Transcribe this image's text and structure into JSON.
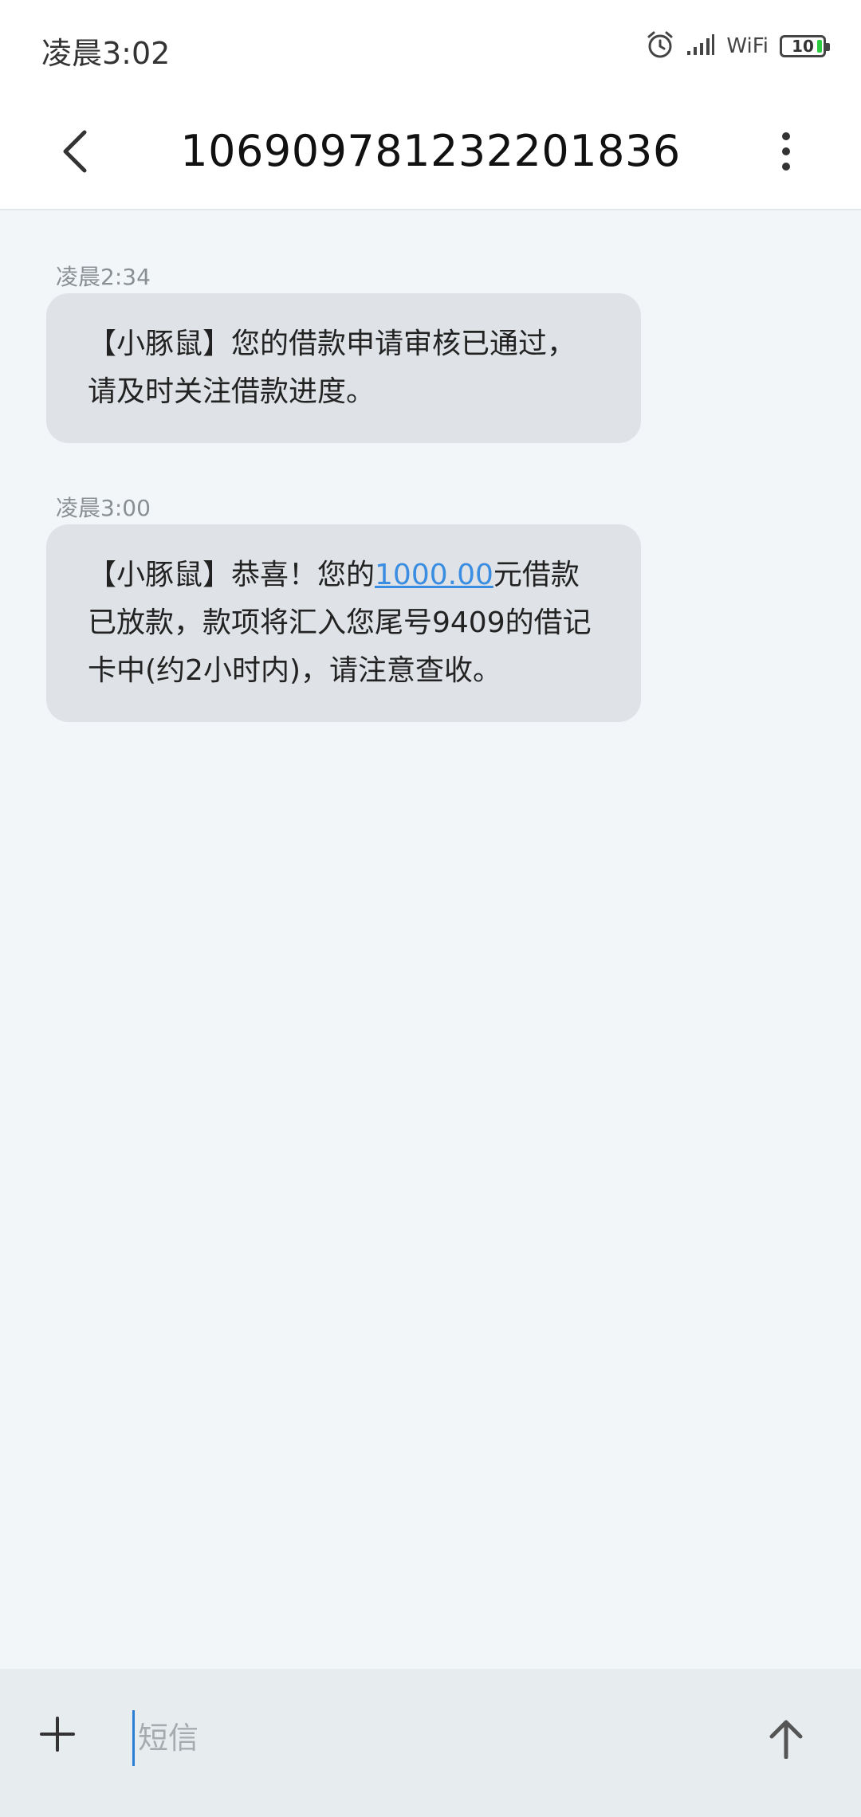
{
  "status_bar": {
    "time": "凌晨3:02",
    "wifi_label": "WiFi",
    "battery_level": "10",
    "icons": [
      "alarm-icon",
      "signal-icon",
      "battery-icon"
    ]
  },
  "header": {
    "title": "106909781232201836",
    "icons": [
      "chevron-left-icon",
      "more-vertical-icon"
    ]
  },
  "messages": [
    {
      "time": "凌晨2:34",
      "text": "【小豚鼠】您的借款申请审核已通过，请及时关注借款进度。"
    },
    {
      "time": "凌晨3:00",
      "text_before": "【小豚鼠】恭喜！您的",
      "amount": "1000.00",
      "text_after": "元借款已放款，款项将汇入您尾号9409的借记卡中(约2小时内)，请注意查收。"
    }
  ],
  "compose": {
    "placeholder": "短信",
    "icons": [
      "plus-icon",
      "arrow-up-icon"
    ]
  },
  "colors": {
    "link": "#3a8de0",
    "bubble": "#dfe2e7",
    "background": "#f2f6f9",
    "battery_fill": "#2ecc40"
  }
}
